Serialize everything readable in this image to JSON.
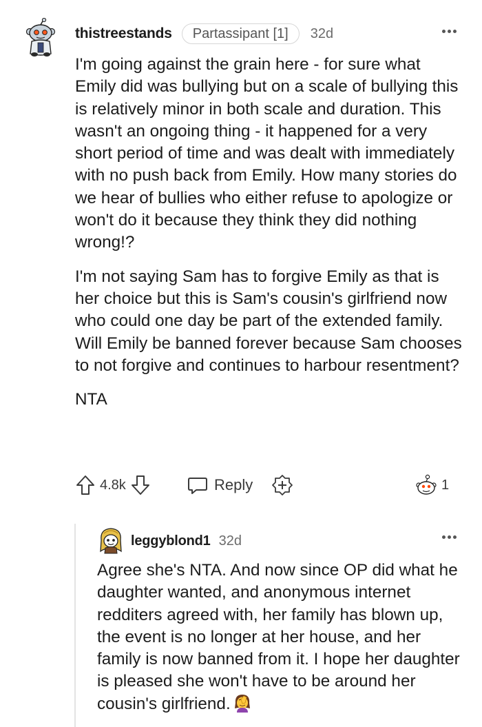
{
  "comment": {
    "username": "thistreestands",
    "flair": "Partassipant [1]",
    "age": "32d",
    "paragraphs": [
      "I'm going against the grain here - for sure what Emily did was bullying but on a scale of bullying this is relatively minor in both scale and duration. This wasn't an ongoing thing - it happened for a very short period of time and was dealt with immediately with no push back from Emily. How many stories do we hear of bullies who either refuse to apologize or won't do it because they think they did nothing wrong!?",
      "I'm not saying Sam has to forgive Emily as that is her choice but this is Sam's cousin's girlfriend now who could one day be part of the extended family. Will Emily be banned forever because Sam chooses to not forgive and continues to harbour resentment?",
      "NTA"
    ],
    "votes": "4.8k",
    "reply_label": "Reply",
    "award_count": "1"
  },
  "reply": {
    "username": "leggyblond1",
    "age": "32d",
    "text": "Agree she's NTA. And now since OP did what he daughter wanted, and anonymous internet redditers agreed with, her family has blown up, the event is no longer at her house, and her family is now banned from it. I hope her daughter is pleased she won't have to be around her cousin's girlfriend.",
    "trailing_emoji": "woman-facepalming-emoji"
  },
  "icons": {
    "upvote": "upvote-arrow-icon",
    "downvote": "downvote-arrow-icon",
    "reply": "speech-bubble-icon",
    "award": "add-award-icon",
    "awarded": "snoo-award-icon",
    "more": "more-options-icon"
  }
}
